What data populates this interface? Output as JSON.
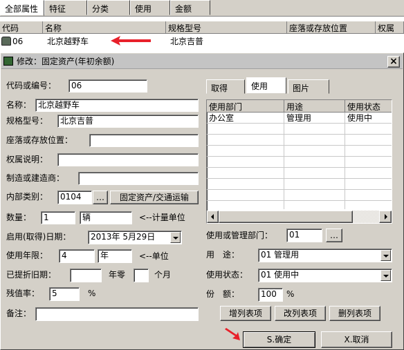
{
  "main_tabs": [
    "全部属性",
    "特征",
    "分类",
    "使用",
    "金额"
  ],
  "list": {
    "headers": [
      "代码",
      "名称",
      "规格型号",
      "座落或存放位置",
      "权属"
    ],
    "row": {
      "code": "06",
      "name": "北京越野车",
      "model": "北京吉普"
    }
  },
  "dialog": {
    "title": "修改：固定资产(年初余额)",
    "close": "×",
    "fields": {
      "code_label": "代码或编号：",
      "code_value": "06",
      "name_label": "名称：",
      "name_value": "北京越野车",
      "model_label": "规格型号：",
      "model_value": "北京吉普",
      "location_label": "座落或存放位置：",
      "location_value": "",
      "ownership_label": "权属说明：",
      "ownership_value": "",
      "maker_label": "制造或建造商：",
      "maker_value": "",
      "category_label": "内部类别：",
      "category_code": "0104",
      "category_btn": "…",
      "category_name": "固定资产/交通运输",
      "qty_label": "数量：",
      "qty_value": "1",
      "unit_value": "辆",
      "unit_hint": "<--计量单位",
      "start_label": "启用(取得)日期：",
      "start_value": "2013年 5月29日",
      "life_label": "使用年限：",
      "life_value": "4",
      "life_unit": "年",
      "life_hint": "<--单位",
      "dep_label": "已提折旧期：",
      "dep_years": "",
      "dep_year_txt": "年零",
      "dep_months": "",
      "dep_month_txt": "个月",
      "residual_label": "残值率：",
      "residual_value": "5",
      "residual_pct": "%",
      "remark_label": "备注：",
      "remark_value": ""
    },
    "right_tabs": [
      "取得",
      "使用",
      "图片"
    ],
    "usage_table": {
      "headers": [
        "使用部门",
        "用途",
        "使用状态"
      ],
      "rows": [
        [
          "办公室",
          "管理用",
          "使用中"
        ]
      ]
    },
    "dept_label": "使用或管理部门：",
    "dept_value": "01",
    "dept_btn": "…",
    "purpose_label": "用　途：",
    "purpose_value": "01 管理用",
    "status_label": "使用状态：",
    "status_value": "01 使用中",
    "share_label": "份　额：",
    "share_value": "100",
    "share_pct": "%",
    "row_buttons": [
      "增列表项",
      "改列表项",
      "删列表项"
    ],
    "ok_label": "S.确定",
    "cancel_label": "X.取消"
  },
  "colors": {
    "arrow": "#e8202a",
    "titlebar": "#c4c4c4",
    "face": "#d4d0c8"
  }
}
